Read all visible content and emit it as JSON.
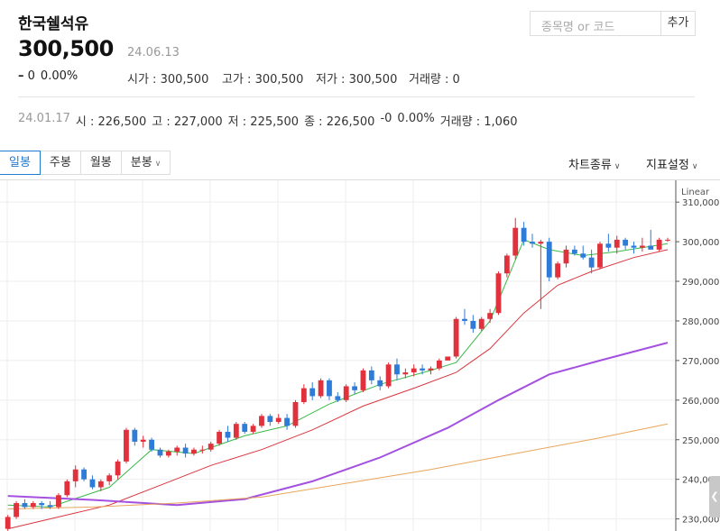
{
  "stock": {
    "name": "한국쉘석유",
    "price": "300,500",
    "date": "24.06.13",
    "change_sign": "–",
    "change": "0",
    "change_pct": "0.00%",
    "open_label": "시가 :",
    "open": "300,500",
    "high_label": "고가 :",
    "high": "300,500",
    "low_label": "저가 :",
    "low": "300,500",
    "volume_label": "거래량 :",
    "volume": "0"
  },
  "search": {
    "placeholder": "종목명 or 코드",
    "add_label": "추가"
  },
  "prev_day": {
    "date": "24.01.17",
    "open_label": "시 :",
    "open": "226,500",
    "high_label": "고 :",
    "high": "227,000",
    "low_label": "저 :",
    "low": "225,500",
    "close_label": "종 :",
    "close": "226,500",
    "change": "-0",
    "change_pct": "0.00%",
    "volume_label": "거래량 :",
    "volume": "1,060"
  },
  "tabs": [
    {
      "label": "일봉"
    },
    {
      "label": "주봉"
    },
    {
      "label": "월봉"
    },
    {
      "label": "분봉"
    }
  ],
  "menus": {
    "chart_type": "차트종류",
    "indicators": "지표설정"
  },
  "colors": {
    "up": "#e0313c",
    "down": "#2f7bd8",
    "ma5": "#3bb94a",
    "ma20": "#d9363e",
    "ma60": "#a450e0",
    "ma120": "#e8a65a",
    "accent": "#1f7ad3"
  },
  "chart_data": {
    "type": "candlestick",
    "scale_label": "Linear",
    "y_ticks": [
      "310,000",
      "300,000",
      "290,000",
      "280,000",
      "270,000",
      "260,000",
      "250,000",
      "240,000",
      "230,000"
    ],
    "ylim": [
      229000,
      313000
    ],
    "candles": [
      [
        227500,
        231000,
        227000,
        230500
      ],
      [
        230500,
        234500,
        230000,
        234000
      ],
      [
        234000,
        235000,
        232500,
        233000
      ],
      [
        233000,
        234500,
        232500,
        234000
      ],
      [
        234000,
        234500,
        232500,
        233500
      ],
      [
        233500,
        234500,
        232500,
        233000
      ],
      [
        233000,
        236500,
        232500,
        236000
      ],
      [
        236000,
        240000,
        235500,
        239500
      ],
      [
        239500,
        243500,
        238000,
        242500
      ],
      [
        242500,
        243000,
        239500,
        240000
      ],
      [
        240000,
        241000,
        237500,
        238000
      ],
      [
        238000,
        240000,
        237000,
        239500
      ],
      [
        239500,
        241500,
        238500,
        241000
      ],
      [
        241000,
        245000,
        240000,
        244500
      ],
      [
        244500,
        253000,
        244000,
        252500
      ],
      [
        252500,
        253000,
        248500,
        249500
      ],
      [
        249500,
        251000,
        248000,
        250000
      ],
      [
        250000,
        250500,
        247000,
        247500
      ],
      [
        247500,
        248000,
        245500,
        246000
      ],
      [
        246000,
        247500,
        245500,
        247000
      ],
      [
        247000,
        248500,
        246000,
        248000
      ],
      [
        248000,
        249000,
        245500,
        246500
      ],
      [
        246500,
        248000,
        246000,
        247500
      ],
      [
        247500,
        248500,
        246500,
        247500
      ],
      [
        247500,
        249500,
        247000,
        249000
      ],
      [
        249000,
        252500,
        248500,
        252000
      ],
      [
        252000,
        253500,
        249500,
        250500
      ],
      [
        250500,
        254500,
        250000,
        254000
      ],
      [
        254000,
        254500,
        251500,
        252000
      ],
      [
        252000,
        254000,
        251500,
        253500
      ],
      [
        253500,
        256500,
        253000,
        256000
      ],
      [
        256000,
        256500,
        253500,
        254500
      ],
      [
        254500,
        256500,
        254000,
        255500
      ],
      [
        255500,
        256500,
        252500,
        253500
      ],
      [
        253500,
        260000,
        253000,
        259500
      ],
      [
        259500,
        264000,
        259000,
        263000
      ],
      [
        263000,
        264500,
        260000,
        261000
      ],
      [
        261000,
        265500,
        260500,
        265000
      ],
      [
        265000,
        265500,
        260000,
        261000
      ],
      [
        261000,
        262000,
        259500,
        260000
      ],
      [
        260000,
        264000,
        259500,
        263500
      ],
      [
        263500,
        264500,
        261500,
        262500
      ],
      [
        262500,
        268000,
        262000,
        267500
      ],
      [
        267500,
        268500,
        264000,
        265000
      ],
      [
        265000,
        266000,
        262500,
        263500
      ],
      [
        263500,
        269500,
        263000,
        269000
      ],
      [
        269000,
        270500,
        265000,
        266500
      ],
      [
        266500,
        268000,
        265500,
        267000
      ],
      [
        267000,
        269000,
        266000,
        268000
      ],
      [
        268000,
        269000,
        266500,
        267500
      ],
      [
        267500,
        268500,
        266500,
        268000
      ],
      [
        268000,
        270500,
        267500,
        270000
      ],
      [
        270000,
        271000,
        271000,
        271000
      ],
      [
        271000,
        281000,
        270500,
        280500
      ],
      [
        280500,
        283000,
        279000,
        280000
      ],
      [
        280000,
        281500,
        277000,
        278000
      ],
      [
        278000,
        281000,
        277500,
        280500
      ],
      [
        280500,
        283000,
        279500,
        282000
      ],
      [
        282000,
        292500,
        281500,
        292000
      ],
      [
        292000,
        297000,
        291000,
        296500
      ],
      [
        296500,
        306000,
        295500,
        303500
      ],
      [
        303500,
        305000,
        299000,
        300000
      ],
      [
        300000,
        302000,
        298500,
        299500
      ],
      [
        299500,
        300500,
        283000,
        300000
      ],
      [
        300000,
        301000,
        290000,
        291000
      ],
      [
        291000,
        295000,
        290500,
        294500
      ],
      [
        294500,
        299000,
        293500,
        298000
      ],
      [
        298000,
        299000,
        296500,
        297000
      ],
      [
        297000,
        299000,
        295500,
        296000
      ],
      [
        296000,
        298000,
        292000,
        293500
      ],
      [
        293500,
        300000,
        293000,
        299500
      ],
      [
        299500,
        302000,
        297500,
        298500
      ],
      [
        298500,
        301500,
        297000,
        300500
      ],
      [
        300500,
        301000,
        298000,
        299000
      ],
      [
        299000,
        300000,
        297000,
        298500
      ],
      [
        298500,
        301000,
        297500,
        299000
      ],
      [
        299000,
        303000,
        298500,
        298000
      ],
      [
        298000,
        301000,
        297500,
        300500
      ],
      [
        300500,
        301000,
        300000,
        300500
      ]
    ],
    "ma_series": [
      {
        "name": "MA5",
        "values": [
          [
            0,
            233500
          ],
          [
            5,
            233000
          ],
          [
            12,
            238000
          ],
          [
            17,
            247500
          ],
          [
            22,
            246500
          ],
          [
            28,
            251000
          ],
          [
            33,
            253500
          ],
          [
            38,
            259000
          ],
          [
            44,
            264000
          ],
          [
            50,
            267500
          ],
          [
            53,
            269500
          ],
          [
            57,
            280000
          ],
          [
            61,
            300500
          ],
          [
            64,
            298000
          ],
          [
            68,
            296500
          ],
          [
            72,
            297500
          ],
          [
            78,
            299500
          ]
        ]
      },
      {
        "name": "MA20",
        "values": [
          [
            0,
            227500
          ],
          [
            6,
            230500
          ],
          [
            12,
            233500
          ],
          [
            18,
            238500
          ],
          [
            24,
            243500
          ],
          [
            30,
            247500
          ],
          [
            36,
            252500
          ],
          [
            42,
            258500
          ],
          [
            48,
            263000
          ],
          [
            53,
            267000
          ],
          [
            57,
            273000
          ],
          [
            61,
            282000
          ],
          [
            65,
            289000
          ],
          [
            69,
            292500
          ],
          [
            74,
            296000
          ],
          [
            78,
            298000
          ]
        ]
      },
      {
        "name": "MA60",
        "values": [
          [
            0,
            235800
          ],
          [
            10,
            234800
          ],
          [
            20,
            233500
          ],
          [
            28,
            235000
          ],
          [
            36,
            239500
          ],
          [
            44,
            245500
          ],
          [
            52,
            253000
          ],
          [
            58,
            260000
          ],
          [
            64,
            266500
          ],
          [
            70,
            270000
          ],
          [
            78,
            274500
          ]
        ]
      },
      {
        "name": "MA120",
        "values": [
          [
            0,
            232500
          ],
          [
            10,
            233000
          ],
          [
            20,
            234000
          ],
          [
            30,
            235500
          ],
          [
            40,
            239000
          ],
          [
            50,
            242500
          ],
          [
            60,
            246500
          ],
          [
            70,
            250500
          ],
          [
            78,
            254000
          ]
        ]
      }
    ]
  }
}
